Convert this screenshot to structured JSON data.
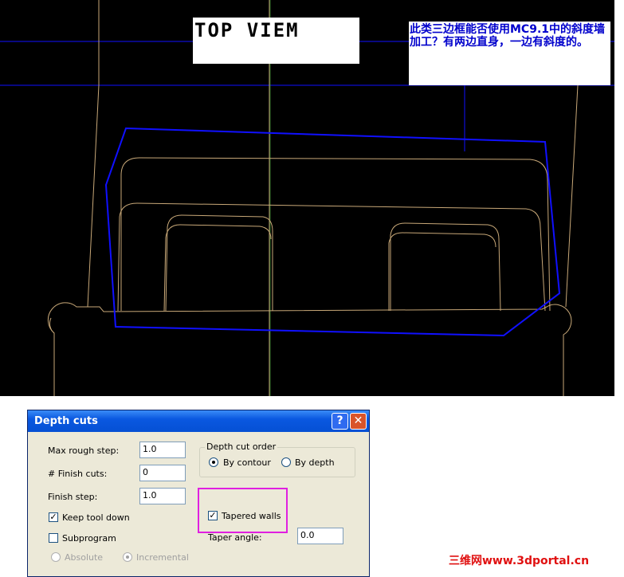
{
  "viewport": {
    "view_label": "TOP VIEM",
    "note": "此类三边框能否使用MC9.1中的斜度墙加工？有两边直身，一边有斜度的。"
  },
  "dialog": {
    "title": "Depth cuts",
    "help_glyph": "?",
    "close_glyph": "✕",
    "max_rough_step": {
      "label": "Max rough step:",
      "value": "1.0"
    },
    "finish_cuts": {
      "label": "# Finish cuts:",
      "value": "0"
    },
    "finish_step": {
      "label": "Finish step:",
      "value": "1.0"
    },
    "keep_tool_down": {
      "label": "Keep tool down",
      "checked": true
    },
    "subprogram": {
      "label": "Subprogram",
      "checked": false
    },
    "absolute": {
      "label": "Absolute",
      "selected": false
    },
    "incremental": {
      "label": "Incremental",
      "selected": true
    },
    "depth_cut_order": {
      "title": "Depth cut order",
      "by_contour": {
        "label": "By contour",
        "selected": true
      },
      "by_depth": {
        "label": "By depth",
        "selected": false
      }
    },
    "tapered_walls": {
      "label": "Tapered walls",
      "checked": true
    },
    "taper_angle": {
      "label": "Taper angle:",
      "value": "0.0"
    }
  },
  "watermark": "三维网www.3dportal.cn",
  "colors": {
    "viewport_bg": "#000000",
    "geometry": "#c8a878",
    "chain": "#1010ff",
    "note_text": "#0000cc",
    "highlight": "#e020e0",
    "watermark": "#e01010"
  }
}
